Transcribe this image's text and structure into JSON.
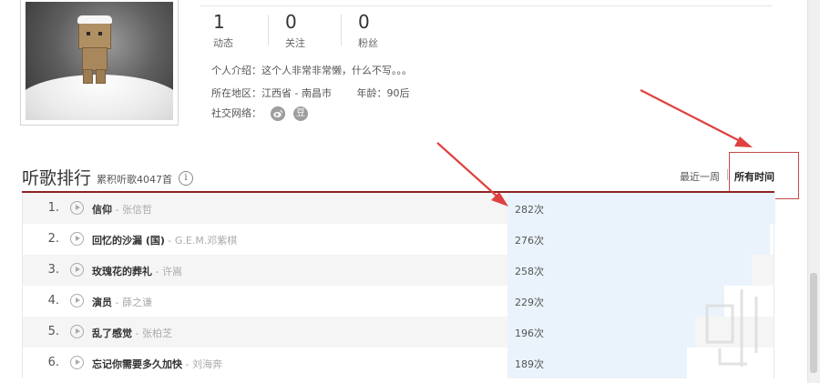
{
  "profile": {
    "stats": [
      {
        "value": "1",
        "label": "动态"
      },
      {
        "value": "0",
        "label": "关注"
      },
      {
        "value": "0",
        "label": "粉丝"
      }
    ],
    "intro": "个人介绍：这个人非常非常懒，什么不写。。。",
    "location_label": "所在地区：",
    "location_value": "江西省 - 南昌市",
    "age_label": "年龄：",
    "age_value": "90后",
    "social_label": "社交网络：",
    "social_icons": [
      "weibo-icon",
      "douban-icon"
    ],
    "douban_glyph": "豆"
  },
  "ranking": {
    "title": "听歌排行",
    "subtitle": "累积听歌4047首",
    "info_glyph": "i",
    "tabs": [
      {
        "label": "最近一周",
        "active": false
      },
      {
        "label": "所有时间",
        "active": true
      }
    ],
    "rows": [
      {
        "index": "1.",
        "name": "信仰",
        "artist": "- 张信哲",
        "count": "282次",
        "share": 1.0
      },
      {
        "index": "2.",
        "name": "回忆的沙漏 (国)",
        "artist": "- G.E.M.邓紫棋",
        "count": "276次",
        "share": 0.98
      },
      {
        "index": "3.",
        "name": "玫瑰花的葬礼",
        "artist": "- 许嵩",
        "count": "258次",
        "share": 0.91
      },
      {
        "index": "4.",
        "name": "演员",
        "artist": "- 薛之谦",
        "count": "229次",
        "share": 0.81
      },
      {
        "index": "5.",
        "name": "乱了感觉",
        "artist": "- 张柏芝",
        "count": "196次",
        "share": 0.7
      },
      {
        "index": "6.",
        "name": "忘记你需要多久加快",
        "artist": "- 刘海奔",
        "count": "189次",
        "share": 0.67
      }
    ]
  },
  "colors": {
    "accent_red": "#8e2323",
    "annotation_red": "#e0403f",
    "bar_blue": "#eaf3fb"
  }
}
